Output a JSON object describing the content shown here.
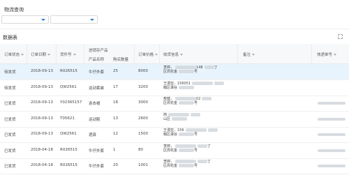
{
  "page": {
    "title": "物流查询",
    "section_title": "数据表",
    "expand_icon": "expand-icon",
    "accent": "#2b7cd3",
    "selected_row_bg": "#e8f4fd"
  },
  "filters": [
    {
      "value": "",
      "icon": "chevron-down-icon"
    },
    {
      "value": "",
      "icon": "chevron-down-icon"
    }
  ],
  "table": {
    "columns": {
      "status": "订单状态",
      "date": "订单日期",
      "item_no": "货件号",
      "group": "进销存产品",
      "product": "产品名称",
      "qty": "购买数量",
      "price": "订单价格",
      "address": "收货信息",
      "note": "备注",
      "tracking": "快递单号"
    },
    "rows": [
      {
        "status": "待发货",
        "date": "2018-09-13",
        "item_no": "R026515",
        "product": "牛仔外套",
        "qty": "25",
        "price": "8000",
        "addr1": "李婷，",
        "addr1b": "148",
        "addr1c": "丁",
        "addr2": "区周花金",
        "addr2b": "号"
      },
      {
        "status": "待发货",
        "date": "2018-09-13",
        "item_no": "QW2561",
        "product": "运动套装",
        "qty": "17",
        "price": "3200",
        "addr1": "王漫亚，156051",
        "addr1b": "",
        "addr1c": "",
        "addr2": "翰区瀑谷",
        "addr2b": ""
      },
      {
        "status": "已发货",
        "date": "2018-09-13",
        "item_no": "Y02365157",
        "product": "连衣裙",
        "qty": "18",
        "price": "3000",
        "addr1": "敖健，",
        "addr1b": "02",
        "addr1c": "",
        "addr2": "区周花金",
        "addr2b": "号"
      },
      {
        "status": "已发货",
        "date": "2018-09-13",
        "item_no": "T05621",
        "product": "运动鞋",
        "qty": "13",
        "price": "2600",
        "addr1": "简",
        "addr1b": "",
        "addr1c": "",
        "addr2": "山区",
        "addr2b": ""
      },
      {
        "status": "已发货",
        "date": "2018-09-13",
        "item_no": "QW2561",
        "product": "透真",
        "qty": "12",
        "price": "1500",
        "addr1": "王漫亚，156",
        "addr1b": "",
        "addr1c": "",
        "addr2": "翰区瀑谷",
        "addr2b": "号"
      },
      {
        "status": "已发货",
        "date": "2018-04-18",
        "item_no": "R026515",
        "product": "牛仔外套",
        "qty": "1",
        "price": "80",
        "addr1": "李婷，",
        "addr1b": "",
        "addr1c": "丁",
        "addr2": "区周花金",
        "addr2b": "号"
      },
      {
        "status": "已发货",
        "date": "2018-04-18",
        "item_no": "R026515",
        "product": "牛仔外套",
        "qty": "20",
        "price": "1001",
        "addr1": "李婷，",
        "addr1b": "",
        "addr1c": "丁",
        "addr2": "区周花金",
        "addr2b": "号"
      }
    ]
  }
}
